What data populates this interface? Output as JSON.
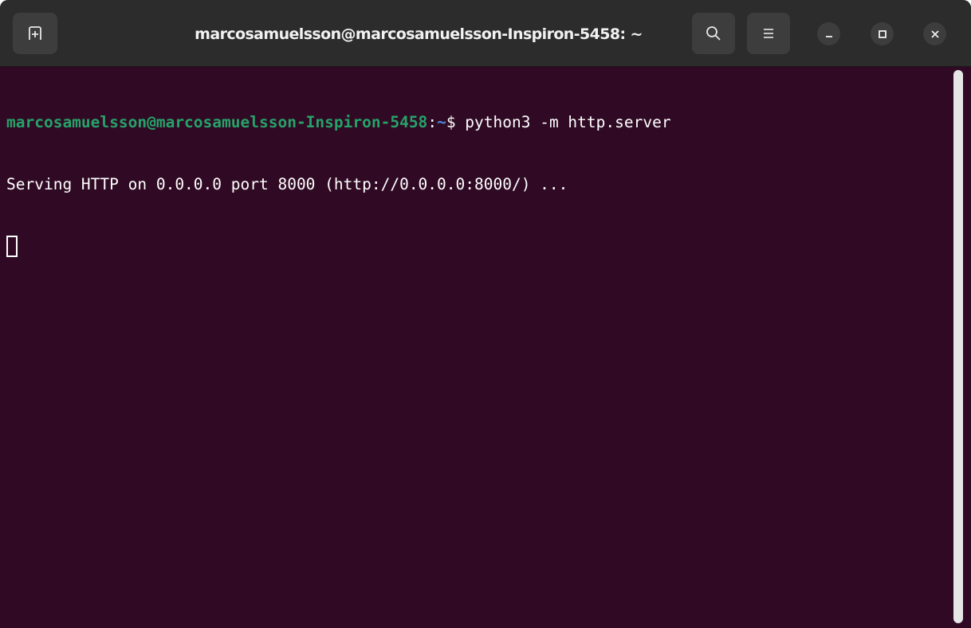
{
  "window": {
    "title": "marcosamuelsson@marcosamuelsson-Inspiron-5458: ~"
  },
  "toolbar": {
    "new_tab_icon": "new-tab-icon",
    "search_icon": "search-icon",
    "menu_icon": "hamburger-menu-icon",
    "minimize_icon": "minimize-icon",
    "maximize_icon": "maximize-icon",
    "close_icon": "close-icon"
  },
  "terminal": {
    "prompt_user": "marcosamuelsson@marcosamuelsson-Inspiron-5458",
    "prompt_colon": ":",
    "prompt_path": "~",
    "prompt_symbol": "$ ",
    "command": "python3 -m http.server",
    "output_line": "Serving HTTP on 0.0.0.0 port 8000 (http://0.0.0.0:8000/) ...",
    "colors": {
      "background": "#300a24",
      "user": "#26a269",
      "path": "#4f8be0",
      "text": "#ffffff"
    }
  }
}
